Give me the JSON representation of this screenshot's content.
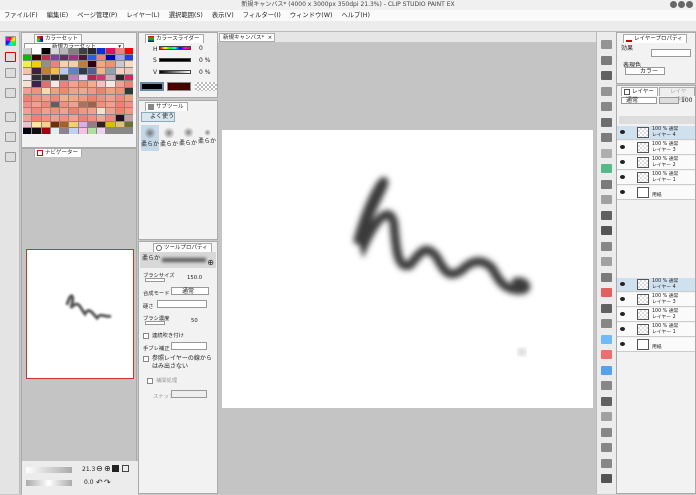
{
  "window": {
    "title": "新規キャンバス* (4000 x 3000px 350dpi 21.3%) - CLIP STUDIO PAINT EX"
  },
  "menu": [
    "ファイル(F)",
    "編集(E)",
    "ページ管理(P)",
    "レイヤー(L)",
    "選択範囲(S)",
    "表示(V)",
    "フィルター(I)",
    "ウィンドウ(W)",
    "ヘルプ(H)"
  ],
  "color_set": {
    "tab": "カラーセット",
    "selected_set": "新規カラーセット",
    "swatches": [
      "#d0d0d0",
      "#ffffff",
      "#000000",
      "#d8d8d8",
      "#b8b8b8",
      "#808080",
      "#404040",
      "#282828",
      "#0030e0",
      "#e01060",
      "#f08080",
      "#ff0000",
      "#00c000",
      "#400000",
      "#c03050",
      "#8040a0",
      "#603060",
      "#a03080",
      "#501830",
      "#2060f0",
      "#f08070",
      "#0000c0",
      "#a0a0f0",
      "#2040f0",
      "#f0f040",
      "#f0d000",
      "#909090",
      "#f08080",
      "#f8d0b0",
      "#f0d0b0",
      "#c08030",
      "#300010",
      "#f0a880",
      "#f09070",
      "#c8c8d0",
      "#f8d8c0",
      "#f8c0a0",
      "#402040",
      "#c08030",
      "#f0c040",
      "#b8c8f0",
      "#6080d0",
      "#303850",
      "#506090",
      "#f8b090",
      "#90a0b0",
      "#f8d0c0",
      "#f0c8c0",
      "#f8e8f0",
      "#303030",
      "#383030",
      "#302828",
      "#383838",
      "#c080c0",
      "#f0d0f0",
      "#c02050",
      "#e03070",
      "#c8b0b8",
      "#282828",
      "#e02060",
      "#f8e0d0",
      "#402050",
      "#e07070",
      "#f8e8e0",
      "#f08080",
      "#f8a090",
      "#f09070",
      "#f8a890",
      "#f8c0c0",
      "#f8e8e0",
      "#f0a090",
      "#f08070",
      "#f0a090",
      "#f09080",
      "#f8d8b0",
      "#f0a080",
      "#f08870",
      "#f0a090",
      "#f0a888",
      "#f09880",
      "#f08070",
      "#f0a080",
      "#f09078",
      "#303838",
      "#f08070",
      "#f09080",
      "#f0a090",
      "#f08878",
      "#f0b090",
      "#f0a888",
      "#f09880",
      "#f08070",
      "#f09080",
      "#f0a090",
      "#f08880",
      "#f0a080",
      "#f09080",
      "#f0a090",
      "#f08878",
      "#606060",
      "#f09080",
      "#f0a090",
      "#b07060",
      "#a06050",
      "#f09080",
      "#f0a090",
      "#f08070",
      "#f09080",
      "#f0a090",
      "#f08880",
      "#f0a090",
      "#f09080",
      "#f0a090",
      "#f08070",
      "#f09880",
      "#f0a090",
      "#f8e0d0",
      "#f0a090",
      "#f08070",
      "#f09880",
      "#f0a090",
      "#f08070",
      "#f09080",
      "#f0a090",
      "#f09080",
      "#f0a090",
      "#f08070",
      "#f09080",
      "#f0a890",
      "#f08880",
      "#201020",
      "#c0a0a0",
      "#f0c0d0",
      "#f8e8a0",
      "#f8d090",
      "#703010",
      "#a06030",
      "#f0d070",
      "#d8b0f0",
      "#908080",
      "#302020",
      "#d8c000",
      "#e0c080",
      "#707030",
      "#000010",
      "#101010",
      "#a00010",
      "#e0f0f0",
      "#908090",
      "#c0d0f0",
      "#f8c0e0",
      "#b0e0a0",
      "#f0d0f0"
    ]
  },
  "navigator": {
    "tab": "ナビゲーター",
    "zoom": "21.3",
    "rotation": "0.0"
  },
  "color_slider": {
    "tab": "カラースライダー",
    "labels": [
      "H",
      "S",
      "V"
    ],
    "values": [
      "0",
      "0 %",
      "0 %"
    ],
    "main_color": "#000000",
    "sub_color": "#4a0000"
  },
  "sub_tool": {
    "tab": "サブツール",
    "group": "よく使う",
    "brushes": [
      "柔らか",
      "柔らか",
      "柔らか",
      "柔らか"
    ]
  },
  "tool_property": {
    "tab": "ツールプロパティ",
    "tool_name": "柔らか",
    "brush_size_label": "ブラシサイズ",
    "brush_size": "150.0",
    "blend_mode_label": "合成モード",
    "blend_mode": "通常",
    "hardness_label": "硬さ",
    "density_label": "ブラシ濃度",
    "density": "50",
    "continuous_spray": "連続吹き付け",
    "stabilization_label": "手ブレ補正",
    "refer_other_layer": "参照レイヤーの線からはみ出さない",
    "vector_snap": "補間処理",
    "snap_label": "スナップ"
  },
  "canvas": {
    "tab": "新規キャンバス*"
  },
  "layer_property": {
    "tab": "レイヤープロパティ",
    "effect_label": "効果",
    "expression_color_label": "表現色",
    "expression_color": "カラー"
  },
  "layer_panel": {
    "tab": "レイヤー",
    "tab2": "レイヤー検索",
    "blend_mode": "通常",
    "opacity": "100",
    "layers": [
      {
        "line1": "100 % 通常",
        "line2": "レイヤー 4",
        "selected": true
      },
      {
        "line1": "100 % 通常",
        "line2": "レイヤー 3"
      },
      {
        "line1": "100 % 通常",
        "line2": "レイヤー 2"
      },
      {
        "line1": "100 % 通常",
        "line2": "レイヤー 1"
      },
      {
        "line1": "",
        "line2": "用紙",
        "paper": true
      }
    ]
  }
}
